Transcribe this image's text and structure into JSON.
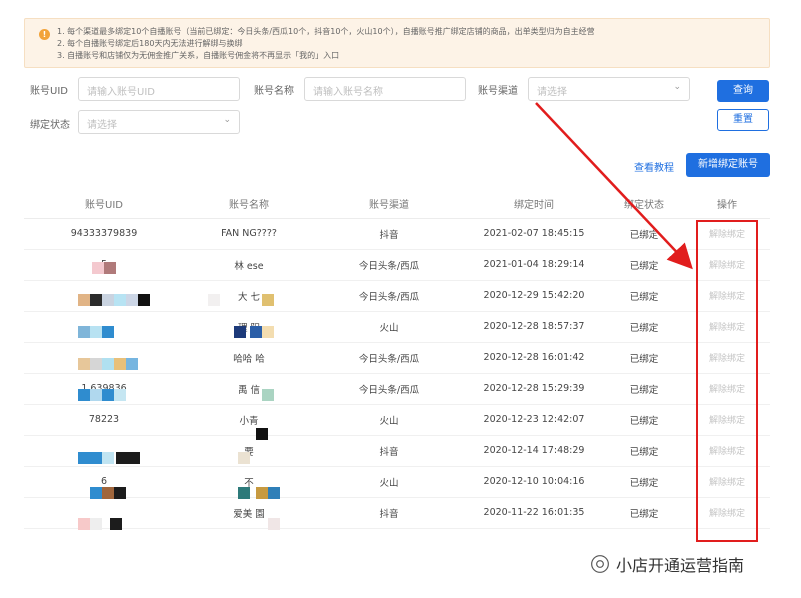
{
  "notice": {
    "icon": "!",
    "lines": [
      "1. 每个渠道最多绑定10个自播账号（当前已绑定：今日头条/西瓜10个，抖音10个，火山10个），自播账号推广绑定店铺的商品，出单类型归为自主经营",
      "2. 每个自播账号绑定后180天内无法进行解绑与换绑",
      "3. 自播账号和店铺仅为无佣金推广关系，自播账号佣金将不再显示「我的」入口"
    ]
  },
  "filters": {
    "uid_label": "账号UID",
    "uid_placeholder": "请输入账号UID",
    "name_label": "账号名称",
    "name_placeholder": "请输入账号名称",
    "channel_label": "账号渠道",
    "channel_placeholder": "请选择",
    "status_label": "绑定状态",
    "status_placeholder": "请选择",
    "query_button": "查询",
    "reset_button": "重置"
  },
  "actions": {
    "tutorial_link": "查看教程",
    "add_button": "新增绑定账号"
  },
  "table": {
    "columns": [
      "账号UID",
      "账号名称",
      "账号渠道",
      "绑定时间",
      "绑定状态",
      "操作"
    ],
    "rows": [
      {
        "uid": "94333379839",
        "name": "FAN   NG????",
        "channel": "抖音",
        "time": "2021-02-07 18:45:15",
        "status": "已绑定",
        "action": "解除绑定"
      },
      {
        "uid": "5",
        "name": "林   ese",
        "channel": "今日头条/西瓜",
        "time": "2021-01-04 18:29:14",
        "status": "已绑定",
        "action": "解除绑定"
      },
      {
        "uid": "",
        "name": "大   七",
        "channel": "今日头条/西瓜",
        "time": "2020-12-29 15:42:20",
        "status": "已绑定",
        "action": "解除绑定"
      },
      {
        "uid": "",
        "name": "理   阳",
        "channel": "火山",
        "time": "2020-12-28 18:57:37",
        "status": "已绑定",
        "action": "解除绑定"
      },
      {
        "uid": "",
        "name": "哈哈   哈",
        "channel": "今日头条/西瓜",
        "time": "2020-12-28 16:01:42",
        "status": "已绑定",
        "action": "解除绑定"
      },
      {
        "uid": "1   639836",
        "name": "禹   信",
        "channel": "今日头条/西瓜",
        "time": "2020-12-28 15:29:39",
        "status": "已绑定",
        "action": "解除绑定"
      },
      {
        "uid": "78223",
        "name": "小青",
        "channel": "火山",
        "time": "2020-12-23 12:42:07",
        "status": "已绑定",
        "action": "解除绑定"
      },
      {
        "uid": "",
        "name": "要   ",
        "channel": "抖音",
        "time": "2020-12-14 17:48:29",
        "status": "已绑定",
        "action": "解除绑定"
      },
      {
        "uid": "6",
        "name": "不",
        "channel": "火山",
        "time": "2020-12-10 10:04:16",
        "status": "已绑定",
        "action": "解除绑定"
      },
      {
        "uid": "",
        "name": "爱美   園",
        "channel": "抖音",
        "time": "2020-11-22 16:01:35",
        "status": "已绑定",
        "action": "解除绑定"
      }
    ]
  },
  "watermark": {
    "text": "小店开通运营指南",
    "icon": "wechat-icon"
  },
  "colors": {
    "primary": "#1f6fe0",
    "annotation_red": "#e11d1d",
    "notice_bg": "#fdf3e7",
    "warning": "#f2a33a"
  }
}
